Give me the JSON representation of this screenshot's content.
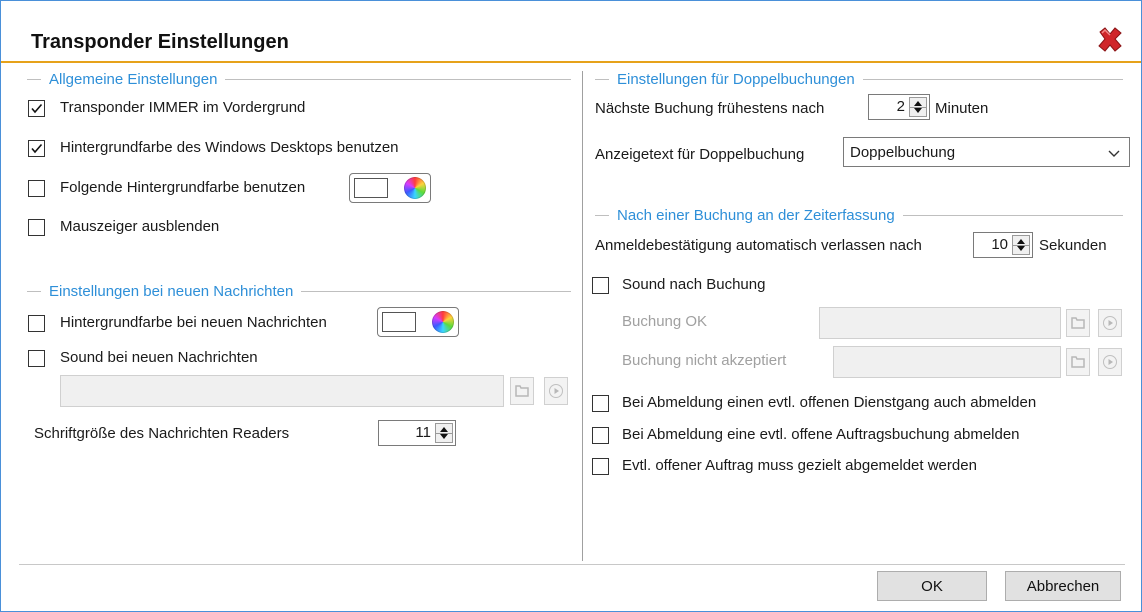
{
  "window": {
    "title": "Transponder Einstellungen"
  },
  "general": {
    "heading": "Allgemeine Einstellungen",
    "always_foreground": {
      "label": "Transponder IMMER im Vordergrund",
      "checked": true
    },
    "use_desktop_bg": {
      "label": "Hintergrundfarbe des Windows Desktops benutzen",
      "checked": true
    },
    "use_custom_bg": {
      "label": "Folgende Hintergrundfarbe benutzen",
      "checked": false
    },
    "hide_cursor": {
      "label": "Mauszeiger ausblenden",
      "checked": false
    }
  },
  "messages": {
    "heading": "Einstellungen bei neuen Nachrichten",
    "bg_new_msg": {
      "label": "Hintergrundfarbe bei neuen Nachrichten",
      "checked": false
    },
    "sound_new_msg": {
      "label": "Sound bei neuen Nachrichten",
      "checked": false
    },
    "sound_file": "",
    "font_size_label": "Schriftgröße des Nachrichten Readers",
    "font_size_value": "11"
  },
  "double_booking": {
    "heading": "Einstellungen für Doppelbuchungen",
    "next_booking_label": "Nächste Buchung frühestens nach",
    "next_booking_value": "2",
    "next_booking_unit": "Minuten",
    "display_text_label": "Anzeigetext für Doppelbuchung",
    "display_text_value": "Doppelbuchung"
  },
  "after_booking": {
    "heading": "Nach einer Buchung an der Zeiterfassung",
    "auto_leave_label": "Anmeldebestätigung automatisch verlassen nach",
    "auto_leave_value": "10",
    "auto_leave_unit": "Sekunden",
    "sound_after": {
      "label": "Sound nach Buchung",
      "checked": false
    },
    "booking_ok_label": "Buchung OK",
    "booking_ok_value": "",
    "booking_rejected_label": "Buchung nicht akzeptiert",
    "booking_rejected_value": "",
    "logout_errand": {
      "label": "Bei Abmeldung einen evtl. offenen Dienstgang auch abmelden",
      "checked": false
    },
    "logout_order": {
      "label": "Bei Abmeldung eine evtl. offene Auftragsbuchung abmelden",
      "checked": false
    },
    "explicit_order": {
      "label": "Evtl. offener Auftrag muss gezielt abgemeldet werden",
      "checked": false
    }
  },
  "buttons": {
    "ok": "OK",
    "cancel": "Abbrechen"
  },
  "icons": {
    "close": "close-x-icon",
    "color_picker": "color-wheel-icon",
    "browse": "folder-icon",
    "play": "play-icon"
  },
  "colors": {
    "accent": "#2e8fd8",
    "title_underline": "#e6a21a",
    "close_red": "#d0262a"
  }
}
